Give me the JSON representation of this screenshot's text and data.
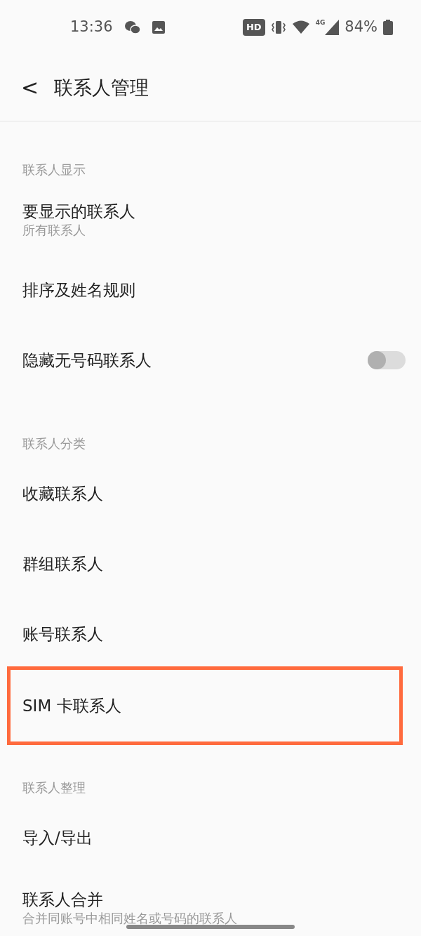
{
  "status_bar": {
    "time": "13:36",
    "hd_badge": "HD",
    "network": "4G",
    "battery": "84%"
  },
  "header": {
    "back": "<",
    "title": "联系人管理"
  },
  "sections": [
    {
      "title": "联系人显示",
      "items": [
        {
          "kind": "plain",
          "title": "要显示的联系人",
          "subtitle": "所有联系人",
          "highlighted": false
        },
        {
          "kind": "plain",
          "title": "排序及姓名规则",
          "highlighted": false
        },
        {
          "kind": "toggle",
          "title": "隐藏无号码联系人",
          "on": false,
          "highlighted": false
        }
      ]
    },
    {
      "title": "联系人分类",
      "items": [
        {
          "kind": "plain",
          "title": "收藏联系人",
          "highlighted": false
        },
        {
          "kind": "plain",
          "title": "群组联系人",
          "highlighted": false
        },
        {
          "kind": "plain",
          "title": "账号联系人",
          "highlighted": false
        },
        {
          "kind": "plain",
          "title": "SIM 卡联系人",
          "highlighted": true
        }
      ]
    },
    {
      "title": "联系人整理",
      "items": [
        {
          "kind": "plain",
          "title": "导入/导出",
          "highlighted": false
        },
        {
          "kind": "plain",
          "title": "联系人合并",
          "subtitle": "合并同账号中相同姓名或号码的联系人",
          "highlighted": false
        }
      ]
    }
  ]
}
